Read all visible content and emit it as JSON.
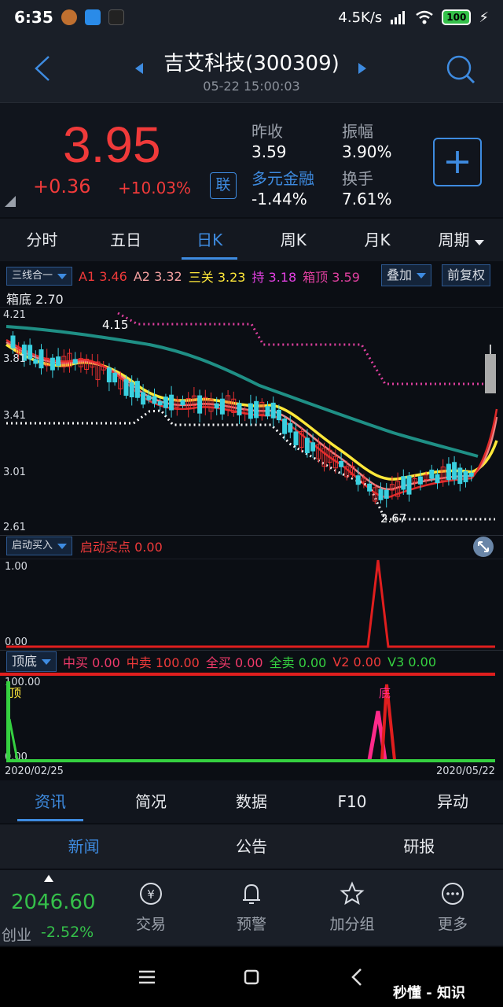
{
  "status": {
    "time": "6:35",
    "speed": "4.5K/s",
    "battery": "100"
  },
  "header": {
    "title": "吉艾科技(300309)",
    "subtitle": "05-22 15:00:03"
  },
  "quote": {
    "price": "3.95",
    "change": "+0.36",
    "change_pct": "+10.03%",
    "lian": "联",
    "prev_close_label": "昨收",
    "prev_close": "3.59",
    "amplitude_label": "振幅",
    "amplitude": "3.90%",
    "sector_label": "多元金融",
    "sector_change": "-1.44%",
    "turnover_label": "换手",
    "turnover": "7.61%"
  },
  "period_tabs": [
    "分时",
    "五日",
    "日K",
    "周K",
    "月K",
    "周期"
  ],
  "main_indicator": {
    "selector": "三线合一",
    "items": [
      {
        "label": "A1",
        "value": "3.46",
        "color": "#f03a3a"
      },
      {
        "label": "A2",
        "value": "3.32",
        "color": "#f4a0a0"
      },
      {
        "label": "三关",
        "value": "3.23",
        "color": "#ffe83a"
      },
      {
        "label": "持",
        "value": "3.18",
        "color": "#e040e0"
      },
      {
        "label": "箱顶",
        "value": "3.59",
        "color": "#e040a0"
      }
    ],
    "overlay_btn": "叠加",
    "adjust_btn": "前复权",
    "box_bottom_label": "箱底",
    "box_bottom_value": "2.70"
  },
  "main_chart": {
    "y_labels": [
      "4.21",
      "3.81",
      "3.41",
      "3.01",
      "2.61"
    ],
    "high_label": "4.15",
    "low_label": "2.67"
  },
  "sub1": {
    "selector": "启动买入",
    "label": "启动买点",
    "value": "0.00",
    "y_top": "1.00",
    "y_bottom": "0.00"
  },
  "sub2": {
    "selector": "顶底",
    "items": [
      {
        "label": "中买",
        "value": "0.00",
        "color": "#f03a6a"
      },
      {
        "label": "中卖",
        "value": "100.00",
        "color": "#f03a3a"
      },
      {
        "label": "全买",
        "value": "0.00",
        "color": "#f03a6a"
      },
      {
        "label": "全卖",
        "value": "0.00",
        "color": "#35d040"
      },
      {
        "label": "V2",
        "value": "0.00",
        "color": "#f03a3a"
      },
      {
        "label": "V3",
        "value": "0.00",
        "color": "#35d040"
      }
    ],
    "y_top": "100.00",
    "y_bottom": "0.00",
    "top_mark": "顶",
    "bottom_mark": "底",
    "date_start": "2020/02/25",
    "date_end": "2020/05/22"
  },
  "bottom_tabs": [
    "资讯",
    "简况",
    "数据",
    "F10",
    "异动"
  ],
  "sub_tabs": [
    "新闻",
    "公告",
    "研报"
  ],
  "toolbar": {
    "index_value": "2046.60",
    "index_name": "创业",
    "index_change": "-2.52%",
    "items": [
      "交易",
      "预警",
      "加分组",
      "更多"
    ]
  },
  "watermark": "秒懂 - 知识"
}
